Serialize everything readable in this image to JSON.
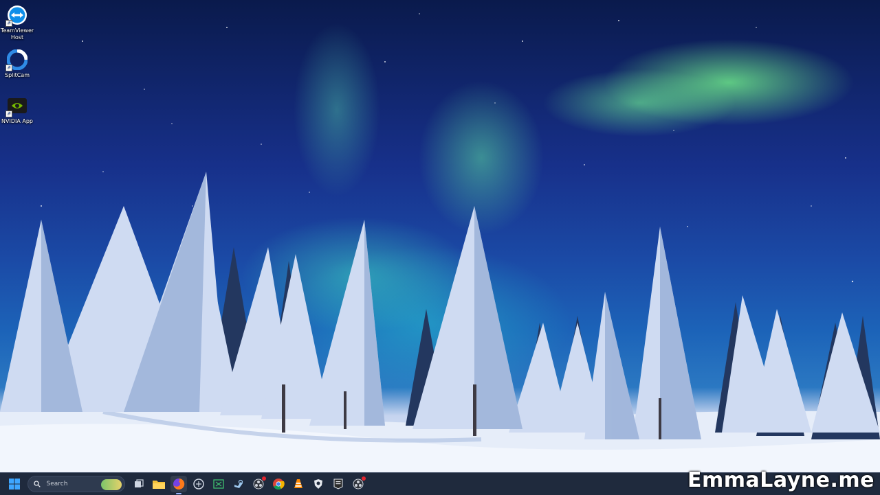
{
  "desktop": {
    "icons": [
      {
        "label": "TeamViewer\nHost",
        "icon": "teamviewer-icon"
      },
      {
        "label": "SplitCam",
        "icon": "splitcam-icon"
      },
      {
        "label": "NVIDIA App",
        "icon": "nvidia-icon"
      }
    ],
    "wallpaper": "aurora-snow-forest"
  },
  "taskbar": {
    "search_label": "Search",
    "apps": [
      {
        "name": "task-view",
        "icon": "task-view-icon"
      },
      {
        "name": "file-explorer",
        "icon": "folder-icon"
      },
      {
        "name": "firefox",
        "icon": "firefox-icon",
        "active": true
      },
      {
        "name": "settings-app",
        "icon": "app-circle-icon"
      },
      {
        "name": "excel-like",
        "icon": "spreadsheet-icon"
      },
      {
        "name": "steam",
        "icon": "steam-icon"
      },
      {
        "name": "obs",
        "icon": "obs-icon",
        "badge": true
      },
      {
        "name": "chrome",
        "icon": "chrome-icon"
      },
      {
        "name": "vlc",
        "icon": "vlc-icon"
      },
      {
        "name": "game-app",
        "icon": "shield-icon"
      },
      {
        "name": "epic-games",
        "icon": "epic-games-icon"
      },
      {
        "name": "obs-2",
        "icon": "obs-icon",
        "badge": true
      }
    ]
  },
  "watermark": "EmmaLayne.me",
  "colors": {
    "taskbar_bg": "#1f2a3d",
    "aurora_green": "#7cff8c",
    "sky_blue": "#1b4aa6"
  }
}
